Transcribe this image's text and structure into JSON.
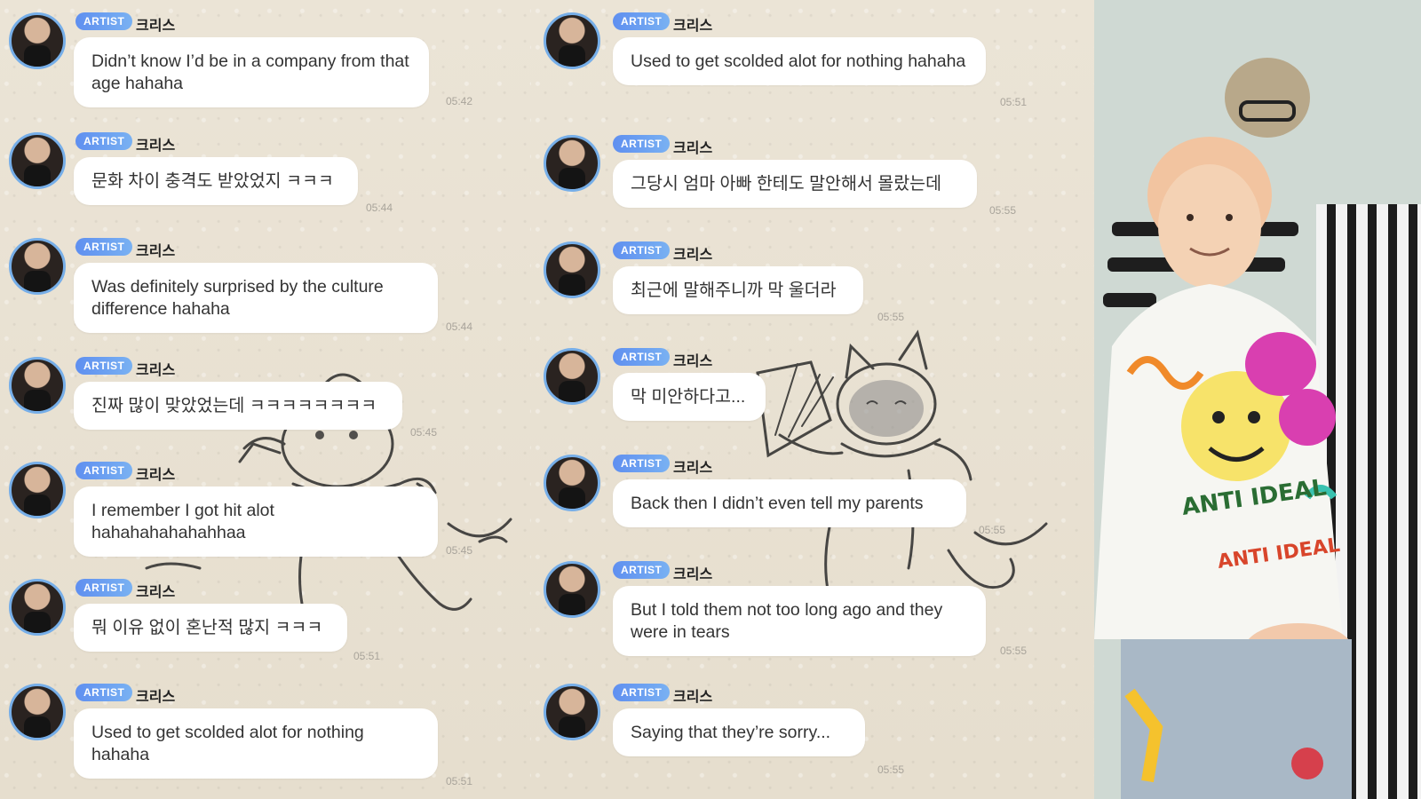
{
  "chat_left": {
    "messages": [
      {
        "badge": "ARTIST",
        "sender": "크리스",
        "text": "Didn’t know I’d be in a company from that age hahaha",
        "time": "05:42"
      },
      {
        "badge": "ARTIST",
        "sender": "크리스",
        "text": "문화 차이 충격도 받았었지 ㅋㅋㅋ",
        "time": "05:44"
      },
      {
        "badge": "ARTIST",
        "sender": "크리스",
        "text": "Was definitely surprised by the culture difference hahaha",
        "time": "05:44"
      },
      {
        "badge": "ARTIST",
        "sender": "크리스",
        "text": "진짜 많이 맞았었는데 ㅋㅋㅋㅋㅋㅋㅋㅋ",
        "time": "05:45"
      },
      {
        "badge": "ARTIST",
        "sender": "크리스",
        "text": "I remember I got hit alot hahahahahahahhaa",
        "time": "05:45"
      },
      {
        "badge": "ARTIST",
        "sender": "크리스",
        "text": "뭐 이유 없이 혼난적 많지 ㅋㅋㅋ",
        "time": "05:51"
      },
      {
        "badge": "ARTIST",
        "sender": "크리스",
        "text": "Used to get scolded alot for nothing hahaha",
        "time": "05:51"
      }
    ]
  },
  "chat_middle": {
    "messages": [
      {
        "badge": "ARTIST",
        "sender": "크리스",
        "text": "Used to get scolded alot for nothing hahaha",
        "time": "05:51"
      },
      {
        "badge": "ARTIST",
        "sender": "크리스",
        "text": "그당시 엄마 아빠 한테도 말안해서 몰랐는데",
        "time": "05:55"
      },
      {
        "badge": "ARTIST",
        "sender": "크리스",
        "text": "최근에 말해주니까 막 울더라",
        "time": "05:55"
      },
      {
        "badge": "ARTIST",
        "sender": "크리스",
        "text": "막 미안하다고...",
        "time": ""
      },
      {
        "badge": "ARTIST",
        "sender": "크리스",
        "text": "Back then I didn’t even tell my parents",
        "time": "05:55"
      },
      {
        "badge": "ARTIST",
        "sender": "크리스",
        "text": "But I told them not too long ago and they were in tears",
        "time": "05:55"
      },
      {
        "badge": "ARTIST",
        "sender": "크리스",
        "text": "Saying that they’re sorry...",
        "time": "05:55"
      }
    ]
  },
  "photo": {
    "shirt_text": "ANTI IDEAL"
  },
  "colors": {
    "badge": "#6a9ef0",
    "bubble": "#ffffff",
    "background": "#e9e1d2",
    "avatar_ring": "#76aee8"
  }
}
